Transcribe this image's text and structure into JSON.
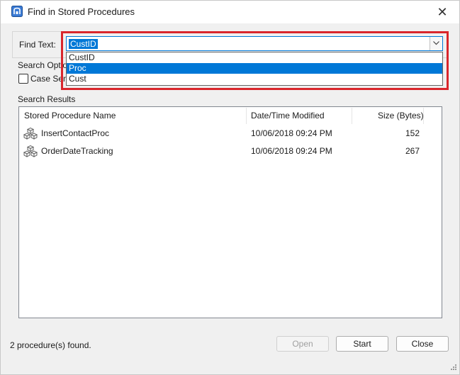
{
  "window": {
    "title": "Find in Stored Procedures",
    "close_glyph": "✕"
  },
  "find": {
    "label": "Find Text:",
    "value": "CustID",
    "options": [
      "CustID",
      "Proc",
      "Cust"
    ],
    "selected_option_index": 1
  },
  "search_options": {
    "label": "Search Optio",
    "case_label": "Case Sens",
    "case_checked": false
  },
  "results": {
    "label": "Search Results",
    "columns": [
      "Stored Procedure Name",
      "Date/Time Modified",
      "Size (Bytes)"
    ],
    "rows": [
      {
        "name": "InsertContactProc",
        "modified": "10/06/2018 09:24 PM",
        "size": "152"
      },
      {
        "name": "OrderDateTracking",
        "modified": "10/06/2018 09:24 PM",
        "size": "267"
      }
    ]
  },
  "status": "2 procedure(s) found.",
  "buttons": {
    "open": "Open",
    "start": "Start",
    "close": "Close"
  },
  "colors": {
    "accent": "#0078d7",
    "highlight_box": "#d9262c"
  }
}
